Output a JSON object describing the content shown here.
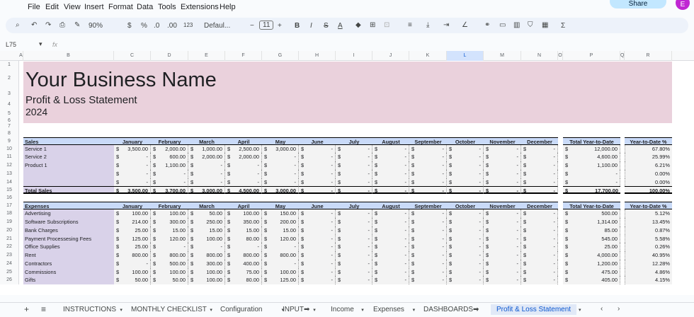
{
  "menu": [
    "File",
    "Edit",
    "View",
    "Insert",
    "Format",
    "Data",
    "Tools",
    "Extensions",
    "Help"
  ],
  "share_label": "Share",
  "avatar_letter": "E",
  "toolbar": {
    "zoom": "90%",
    "currency": "$",
    "percent": "%",
    "dec_dec": ".0",
    "inc_dec": ".00",
    "num_fmt": "123",
    "font": "Defaul...",
    "font_size": "11",
    "bold": "B",
    "italic": "I",
    "strike": "S",
    "textcolor": "A",
    "sum": "Σ"
  },
  "namebox": "L75",
  "fx": "fx",
  "columns": [
    "A",
    "B",
    "C",
    "D",
    "E",
    "F",
    "G",
    "H",
    "I",
    "J",
    "K",
    "L",
    "M",
    "N",
    "O",
    "P",
    "Q",
    "R"
  ],
  "rows": [
    "1",
    "2",
    "3",
    "4",
    "5",
    "6",
    "7",
    "8",
    "9",
    "10",
    "11",
    "12",
    "13",
    "14",
    "15",
    "16",
    "17",
    "18",
    "19",
    "20",
    "21",
    "22",
    "23",
    "24",
    "25",
    "26"
  ],
  "banner": {
    "title": "Your Business Name",
    "subtitle": "Profit & Loss Statement",
    "year": "2024"
  },
  "months": [
    "January",
    "February",
    "March",
    "April",
    "May",
    "June",
    "July",
    "August",
    "September",
    "October",
    "November",
    "December"
  ],
  "total_ytd": "Total Year-to-Date",
  "ytd_pct": "Year-to-Date %",
  "dollar": "$",
  "sales": {
    "header": "Sales",
    "total_label": "Total Sales",
    "rows": [
      {
        "label": "Service 1",
        "vals": [
          "3,500.00",
          "2,000.00",
          "1,000.00",
          "2,500.00",
          "3,000.00",
          "-",
          "-",
          "-",
          "-",
          "-",
          "-",
          "-"
        ],
        "ytd": "12,000.00",
        "pct": "67.80%"
      },
      {
        "label": "Service 2",
        "vals": [
          "-",
          "600.00",
          "2,000.00",
          "2,000.00",
          "-",
          "-",
          "-",
          "-",
          "-",
          "-",
          "-",
          "-"
        ],
        "ytd": "4,600.00",
        "pct": "25.99%"
      },
      {
        "label": "Product 1",
        "vals": [
          "-",
          "1,100.00",
          "-",
          "-",
          "-",
          "-",
          "-",
          "-",
          "-",
          "-",
          "-",
          "-"
        ],
        "ytd": "1,100.00",
        "pct": "6.21%"
      },
      {
        "label": "",
        "vals": [
          "-",
          "-",
          "-",
          "-",
          "-",
          "-",
          "-",
          "-",
          "-",
          "-",
          "-",
          "-"
        ],
        "ytd": "-",
        "pct": "0.00%"
      },
      {
        "label": "",
        "vals": [
          "-",
          "-",
          "-",
          "-",
          "-",
          "-",
          "-",
          "-",
          "-",
          "-",
          "-",
          "-"
        ],
        "ytd": "-",
        "pct": "0.00%"
      }
    ],
    "total": {
      "vals": [
        "3,500.00",
        "3,700.00",
        "3,000.00",
        "4,500.00",
        "3,000.00",
        "-",
        "-",
        "-",
        "-",
        "-",
        "-",
        "-"
      ],
      "ytd": "17,700.00",
      "pct": "100.00%"
    }
  },
  "expenses": {
    "header": "Expenses",
    "rows": [
      {
        "label": "Advertising",
        "vals": [
          "100.00",
          "100.00",
          "50.00",
          "100.00",
          "150.00",
          "-",
          "-",
          "-",
          "-",
          "-",
          "-",
          "-"
        ],
        "ytd": "500.00",
        "pct": "5.12%"
      },
      {
        "label": "Software Subscriptions",
        "vals": [
          "214.00",
          "300.00",
          "250.00",
          "350.00",
          "200.00",
          "-",
          "-",
          "-",
          "-",
          "-",
          "-",
          "-"
        ],
        "ytd": "1,314.00",
        "pct": "13.45%"
      },
      {
        "label": "Bank Charges",
        "vals": [
          "25.00",
          "15.00",
          "15.00",
          "15.00",
          "15.00",
          "-",
          "-",
          "-",
          "-",
          "-",
          "-",
          "-"
        ],
        "ytd": "85.00",
        "pct": "0.87%"
      },
      {
        "label": "Payment Processesing Fees",
        "vals": [
          "125.00",
          "120.00",
          "100.00",
          "80.00",
          "120.00",
          "-",
          "-",
          "-",
          "-",
          "-",
          "-",
          "-"
        ],
        "ytd": "545.00",
        "pct": "5.58%"
      },
      {
        "label": "Office Supplies",
        "vals": [
          "25.00",
          "-",
          "-",
          "-",
          "-",
          "-",
          "-",
          "-",
          "-",
          "-",
          "-",
          "-"
        ],
        "ytd": "25.00",
        "pct": "0.26%"
      },
      {
        "label": "Rent",
        "vals": [
          "800.00",
          "800.00",
          "800.00",
          "800.00",
          "800.00",
          "-",
          "-",
          "-",
          "-",
          "-",
          "-",
          "-"
        ],
        "ytd": "4,000.00",
        "pct": "40.95%"
      },
      {
        "label": "Contractors",
        "vals": [
          "-",
          "500.00",
          "300.00",
          "400.00",
          "-",
          "-",
          "-",
          "-",
          "-",
          "-",
          "-",
          "-"
        ],
        "ytd": "1,200.00",
        "pct": "12.28%"
      },
      {
        "label": "Commissions",
        "vals": [
          "100.00",
          "100.00",
          "100.00",
          "75.00",
          "100.00",
          "-",
          "-",
          "-",
          "-",
          "-",
          "-",
          "-"
        ],
        "ytd": "475.00",
        "pct": "4.86%"
      },
      {
        "label": "Gifts",
        "vals": [
          "50.00",
          "50.00",
          "100.00",
          "80.00",
          "125.00",
          "-",
          "-",
          "-",
          "-",
          "-",
          "-",
          "-"
        ],
        "ytd": "405.00",
        "pct": "4.15%"
      }
    ]
  },
  "tabs": [
    "INSTRUCTIONS",
    "MONTHLY CHECKLIST",
    "Configuration",
    "INPUT➡",
    "Income",
    "Expenses",
    "DASHBOARDS➡",
    "Profit & Loss Statement"
  ],
  "active_tab": "Profit & Loss Statement"
}
